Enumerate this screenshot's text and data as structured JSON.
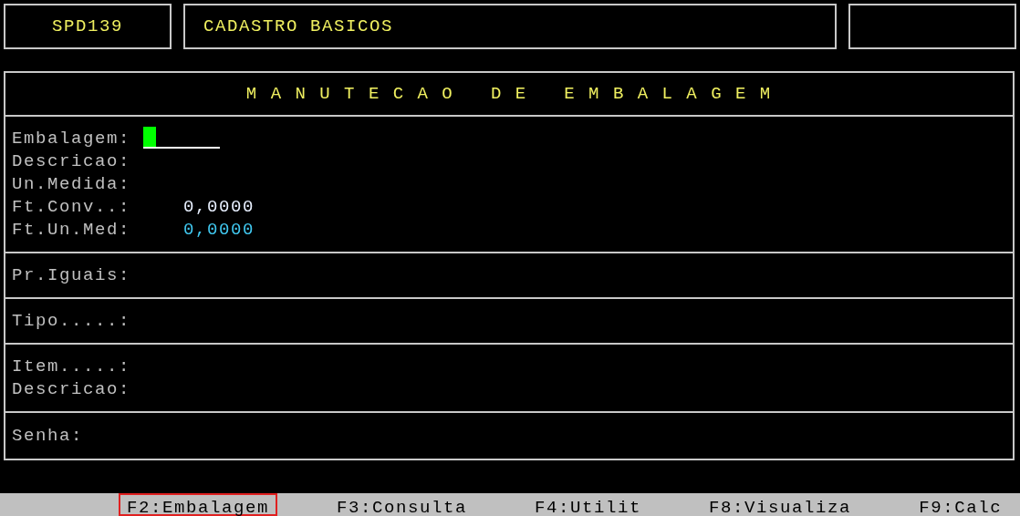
{
  "header": {
    "program_code": "SPD139",
    "module_title": "CADASTRO BASICOS"
  },
  "form": {
    "title": "M A N U T E C A O   D E   E M B A L A G E M",
    "sections": [
      {
        "fields": [
          {
            "label": "Embalagem:",
            "kind": "input",
            "focused": true
          },
          {
            "label": "Descricao:",
            "kind": "text"
          },
          {
            "label": "Un.Medida:",
            "kind": "text"
          },
          {
            "label": "Ft.Conv..:",
            "kind": "number",
            "value": "0,0000",
            "accent": false
          },
          {
            "label": "Ft.Un.Med:",
            "kind": "number",
            "value": "0,0000",
            "accent": true
          }
        ]
      },
      {
        "fields": [
          {
            "label": "Pr.Iguais:",
            "kind": "text"
          }
        ]
      },
      {
        "fields": [
          {
            "label": "Tipo.....:",
            "kind": "text"
          }
        ]
      },
      {
        "fields": [
          {
            "label": "Item.....:",
            "kind": "text"
          },
          {
            "label": "Descricao:",
            "kind": "text"
          }
        ]
      },
      {
        "fields": [
          {
            "label": "Senha:",
            "kind": "text"
          }
        ]
      }
    ]
  },
  "function_keys": [
    {
      "label": "F2:Embalagem",
      "selected": true
    },
    {
      "label": "F3:Consulta",
      "selected": false
    },
    {
      "label": "F4:Utilit",
      "selected": false
    },
    {
      "label": "F8:Visualiza",
      "selected": false
    },
    {
      "label": "F9:Calc",
      "selected": false
    }
  ]
}
